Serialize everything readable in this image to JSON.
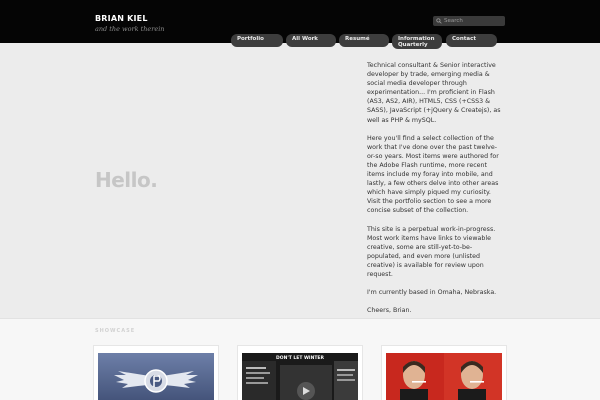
{
  "header": {
    "brand_name": "BRIAN KIEL",
    "tagline": "and the work therein",
    "search_placeholder": "Search",
    "nav": [
      "Portfolio",
      "All Work",
      "Resumé",
      "Information Quarterly",
      "Contact"
    ]
  },
  "intro": {
    "hello": "Hello.",
    "paragraphs": [
      "Technical consultant & Senior interactive developer by trade, emerging media & social media developer through experimentation... I'm proficient in Flash (AS3, AS2, AIR), HTML5, CSS (+CSS3 & SASS), JavaScript (+jQuery & Createjs), as well as PHP & mySQL.",
      "Here you'll find a select collection of the work that I've done over the past twelve-or-so years. Most items were authored for the Adobe Flash runtime, more recent items include my foray into mobile, and lastly, a few others delve into other areas which have simply piqued my curiosity. Visit the portfolio section to see a more concise subset of the collection.",
      "This site is a perpetual work-in-progress. Most work items have links to viewable creative, some are still-yet-to-be-populated, and even more (unlisted creative) is available for review upon request.",
      "I'm currently based in Omaha, Nebraska.",
      "Cheers, Brian."
    ]
  },
  "showcase": {
    "heading": "SHOWCASE",
    "items": [
      {
        "name": "winged-emblem-thumbnail"
      },
      {
        "name": "dont-let-winter-thumbnail",
        "headline": "DON'T LET WINTER"
      },
      {
        "name": "portrait-thumbnail"
      }
    ]
  },
  "colors": {
    "header_bg": "#050505",
    "page_bg": "#ececec",
    "nav_pill": "#3d3d3d",
    "hello_text": "#c6c6c6",
    "body_text": "#333333"
  }
}
